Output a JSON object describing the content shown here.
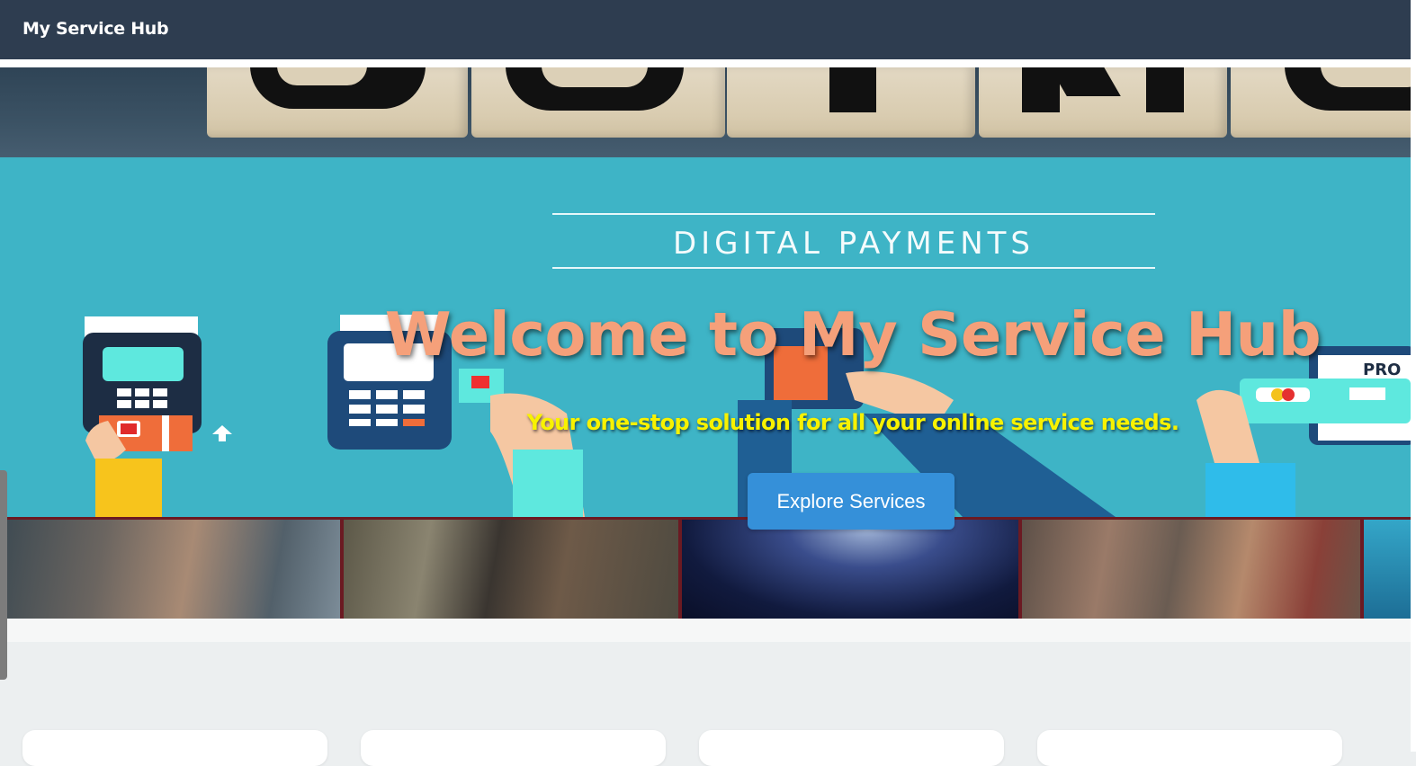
{
  "navbar": {
    "brand": "My Service Hub"
  },
  "banner": {
    "headline": "DIGITAL PAYMENTS",
    "block_letters": [
      "D",
      "O",
      "T",
      "N",
      "O"
    ],
    "screen_label": "PRO"
  },
  "hero": {
    "title": "Welcome to My Service Hub",
    "subtitle": "Your one-stop solution for all your online service needs.",
    "cta_label": "Explore Services"
  },
  "colors": {
    "navbar": "#2e3d50",
    "hero_title": "#f5a07a",
    "hero_subtitle": "#f8f200",
    "cta": "#3590d9",
    "payments_bg": "#3eb4c6"
  },
  "icons": [
    "arrow-up-icon"
  ],
  "cards": [
    {
      "id": "card-1"
    },
    {
      "id": "card-2"
    },
    {
      "id": "card-3"
    },
    {
      "id": "card-4"
    }
  ]
}
